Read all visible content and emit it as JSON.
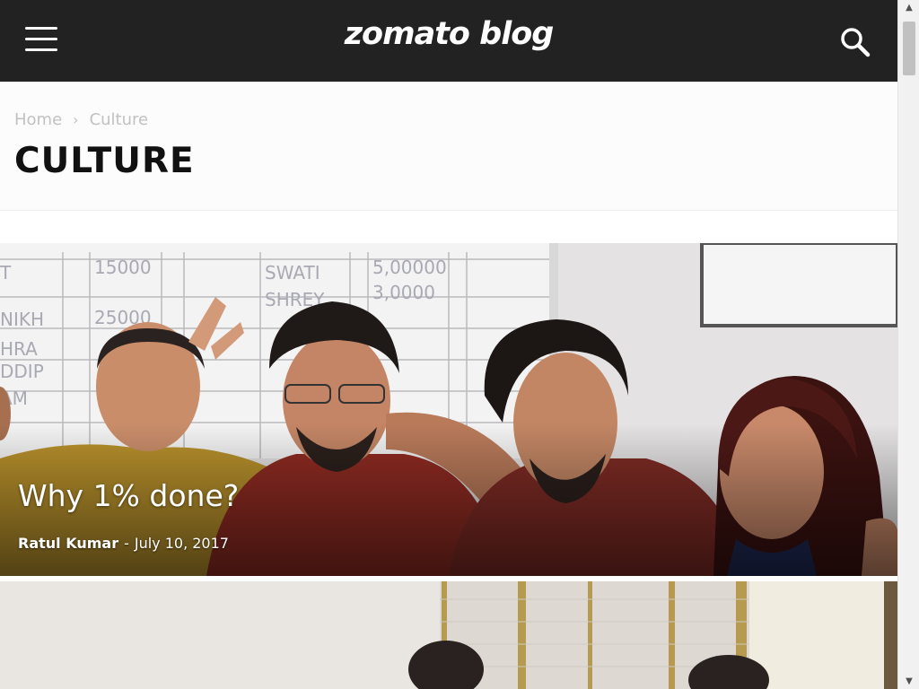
{
  "header": {
    "logo": "zomato blog",
    "menu_icon": "hamburger-menu-icon",
    "search_icon": "search-icon",
    "background": "#222222"
  },
  "breadcrumb": {
    "home": "Home",
    "separator": "›",
    "current": "Culture"
  },
  "page_title": "CULTURE",
  "articles": [
    {
      "title": "Why 1% done?",
      "author": "Ratul Kumar",
      "separator": "-",
      "date": "July 10, 2017"
    },
    {
      "title": "",
      "author": "",
      "date": ""
    }
  ],
  "scrollbar": {
    "up_arrow": "▲",
    "down_arrow": "▼"
  }
}
